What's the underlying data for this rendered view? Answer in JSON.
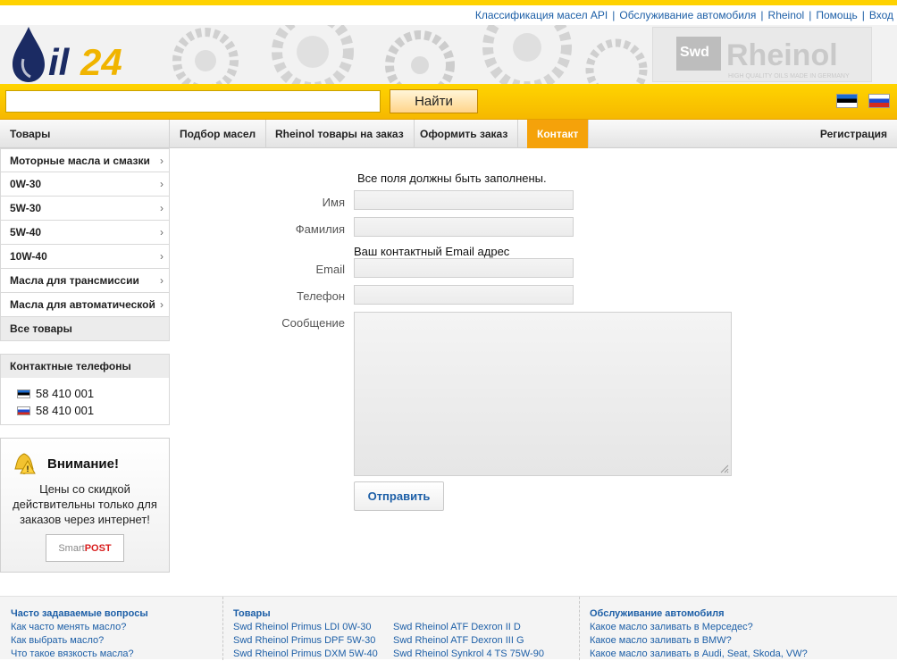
{
  "top_links": [
    "Классификация масел API",
    "Обслуживание автомобиля",
    "Rheinol",
    "Помощь",
    "Вход"
  ],
  "logo": {
    "text": "il24",
    "brand_banner": "Rheinol",
    "brand_small": "Swd",
    "brand_tag": "HIGH QUALITY OILS MADE IN GERMANY"
  },
  "search": {
    "value": "",
    "button_label": "Найти"
  },
  "languages": [
    "et",
    "ru"
  ],
  "nav": {
    "products": "Товары",
    "items": [
      "Подбор масел",
      "Rheinol товары на заказ",
      "Оформить заказ",
      "Контакт"
    ],
    "active_index": 3,
    "register": "Регистрация"
  },
  "sidebar": {
    "categories": [
      "Моторные масла и смазки",
      "0W-30",
      "5W-30",
      "5W-40",
      "10W-40",
      "Масла для трансмиссии",
      "Масла для автоматической"
    ],
    "all_label": "Все товары",
    "phones_title": "Контактные телефоны",
    "phones": [
      "58 410 001",
      "58 410 001"
    ],
    "notice_title": "Внимание!",
    "notice_text": "Цены со скидкой действительны только для заказов через интернет!",
    "smartpost_a": "Smart",
    "smartpost_b": "POST"
  },
  "form": {
    "required_note": "Все поля должны быть заполнены.",
    "first_name_label": "Имя",
    "last_name_label": "Фамилия",
    "email_note": "Ваш контактный Email адрес",
    "email_label": "Email",
    "phone_label": "Телефон",
    "message_label": "Сообщение",
    "submit_label": "Отправить"
  },
  "footer": {
    "faq_title": "Часто задаваемые вопросы",
    "faq_links": [
      "Как часто менять масло?",
      "Как выбрать масло?",
      "Что такое вязкость масла?"
    ],
    "products_title": "Товары",
    "products_col1": [
      "Swd Rheinol Primus LDI 0W-30",
      "Swd Rheinol Primus DPF 5W-30",
      "Swd Rheinol Primus DXM 5W-40"
    ],
    "products_col2": [
      "Swd Rheinol ATF Dexron II D",
      "Swd Rheinol ATF Dexron III G",
      "Swd Rheinol Synkrol 4 TS 75W-90"
    ],
    "service_title": "Обслуживание автомобиля",
    "service_links": [
      "Какое масло заливать в Мерседес?",
      "Какое масло заливать в BMW?",
      "Какое масло заливать в Audi, Seat, Skoda, VW?"
    ]
  },
  "colors": {
    "accent": "#f5a20a",
    "link": "#1d5fa7",
    "search_bar": "#ffd400"
  }
}
